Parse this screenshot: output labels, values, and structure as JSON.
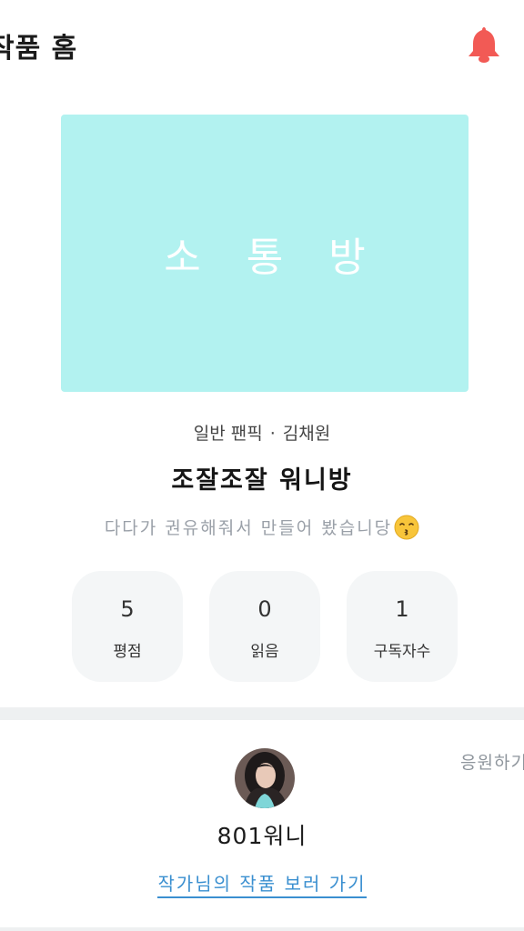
{
  "header": {
    "title": "작품 홈",
    "bell_icon": "bell-icon",
    "bell_color": "#f25a55"
  },
  "cover": {
    "text": "소 통 방",
    "background": "#b2f2f0"
  },
  "work": {
    "category": "일반 팬픽",
    "separator": "·",
    "author": "김채원",
    "title": "조잘조잘 워니방",
    "description": "다다가 권유해줘서 만들어 봤습니당",
    "description_emoji": "kissing-face-with-smiling-eyes-icon"
  },
  "stats": [
    {
      "value": "5",
      "label": "평점"
    },
    {
      "value": "0",
      "label": "읽음"
    },
    {
      "value": "1",
      "label": "구독자수"
    }
  ],
  "author_section": {
    "avatar_icon": "author-avatar",
    "name": "801워니",
    "link": "작가님의 작품 보러 가기",
    "cheer_label": "응원하기"
  }
}
